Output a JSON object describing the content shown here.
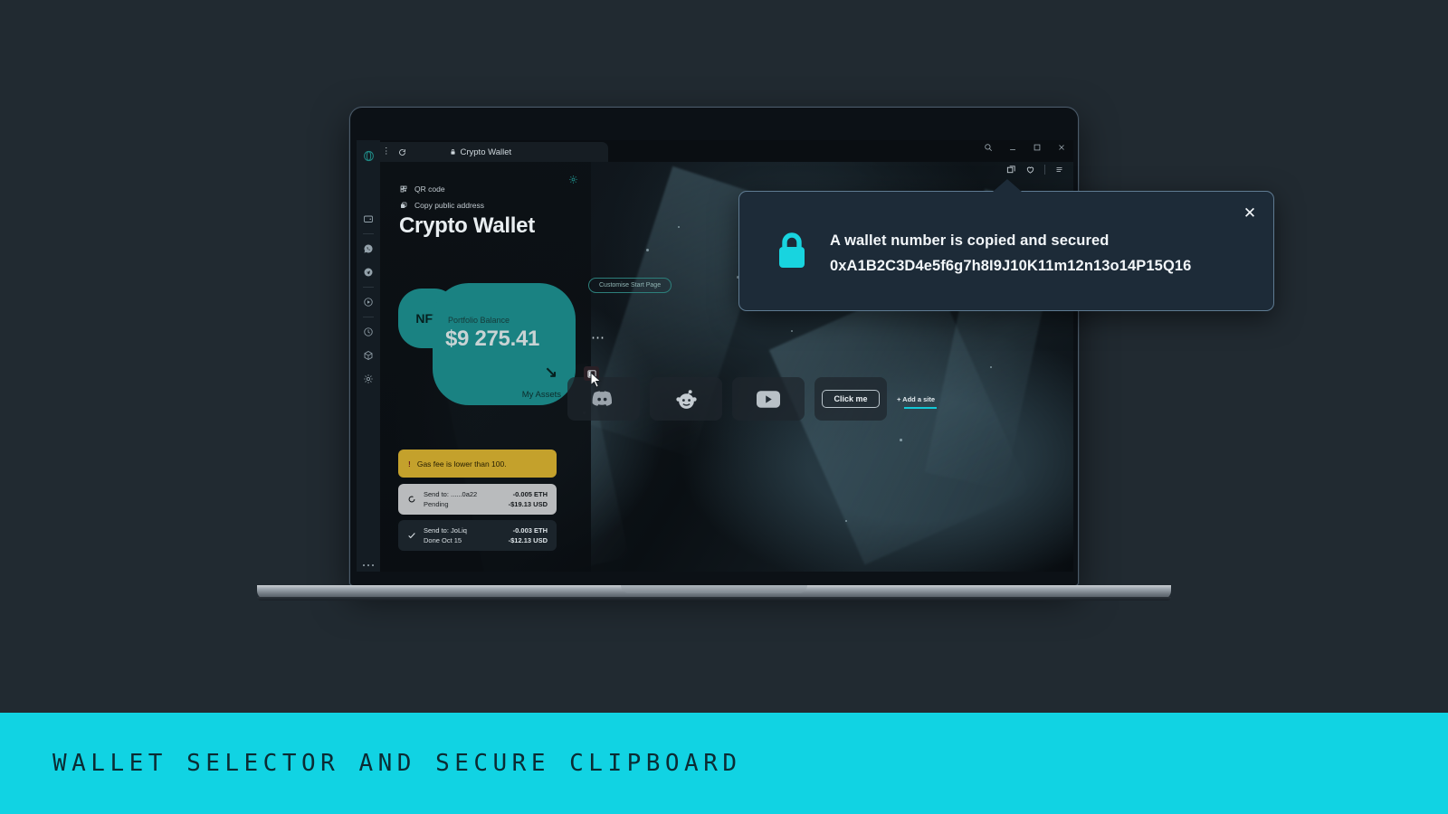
{
  "banner": {
    "caption": "WALLET SELECTOR AND SECURE CLIPBOARD",
    "bg": "#11d3e3"
  },
  "page": {
    "background": "#212a31"
  },
  "browser": {
    "tab": {
      "title": "Crypto Wallet",
      "lock_icon": "lock-icon",
      "menu_icon": "kebab-menu-icon",
      "reload_icon": "reload-icon"
    },
    "window_controls": {
      "search": "search-icon",
      "minimize": "minimize-icon",
      "maximize": "maximize-icon",
      "close": "close-icon"
    },
    "toolbar_right": {
      "tabs_icon": "tab-stack-icon",
      "favorites_icon": "heart-icon",
      "menu_icon": "hamburger-menu-icon"
    },
    "sidebar": {
      "items": [
        {
          "name": "opera-logo-icon",
          "label": "Opera"
        },
        {
          "name": "wallet-icon",
          "label": "Crypto Wallet"
        },
        {
          "name": "whatsapp-icon",
          "label": "WhatsApp"
        },
        {
          "name": "telegram-icon",
          "label": "Telegram"
        },
        {
          "name": "player-icon",
          "label": "Player"
        },
        {
          "name": "history-icon",
          "label": "History"
        },
        {
          "name": "cube-icon",
          "label": "Web3"
        },
        {
          "name": "settings-gear-icon",
          "label": "Settings"
        }
      ],
      "overflow": "more-options"
    }
  },
  "wallet_panel": {
    "settings_icon": "gear-icon",
    "links": [
      {
        "icon": "qr-code-icon",
        "label": "QR code"
      },
      {
        "icon": "copy-icon",
        "label": "Copy public address"
      }
    ],
    "title": "Crypto Wallet",
    "nft_label": "NFT",
    "balance": {
      "label": "Portfolio Balance",
      "amount": "$9 275.41",
      "assets_link": "My Assets",
      "arrow_icon": "arrow-down-right-icon",
      "accent": "#1a8282"
    },
    "gas_fee": {
      "icon": "warning-icon",
      "text": "Gas fee is lower than 100.",
      "bg": "#c4a12c"
    },
    "transactions": [
      {
        "status_icon": "spinner-icon",
        "title": "Send to: ......0a22",
        "subtitle": "Pending",
        "amount_crypto": "-0.005 ETH",
        "amount_fiat": "-$19.13 USD",
        "state": "pending"
      },
      {
        "status_icon": "check-icon",
        "title": "Send to: JoLiq",
        "subtitle": "Done Oct 15",
        "amount_crypto": "-0.003 ETH",
        "amount_fiat": "-$12.13 USD",
        "state": "done"
      }
    ]
  },
  "start_page": {
    "customise_button": "Customise Start Page",
    "overflow_icon": "ellipsis-icon",
    "panel_toggle_icon": "side-panel-toggle-icon",
    "cursor_icon": "mouse-cursor-icon",
    "tiles": [
      {
        "name": "speed-dial-discord",
        "icon": "discord-icon",
        "label": "Discord"
      },
      {
        "name": "speed-dial-reddit",
        "icon": "reddit-icon",
        "label": "Reddit"
      },
      {
        "name": "speed-dial-youtube",
        "icon": "youtube-icon",
        "label": "YouTube"
      },
      {
        "name": "speed-dial-clickme",
        "icon": "button-icon",
        "label": "Click me"
      }
    ],
    "add_site": "+ Add a site"
  },
  "popup": {
    "lock_icon": "lock-icon",
    "line1": "A wallet number is copied and secured",
    "line2": "0xA1B2C3D4e5f6g7h8I9J10K11m12n13o14P15Q16",
    "close_label": "✕",
    "accent": "#18d4df"
  }
}
